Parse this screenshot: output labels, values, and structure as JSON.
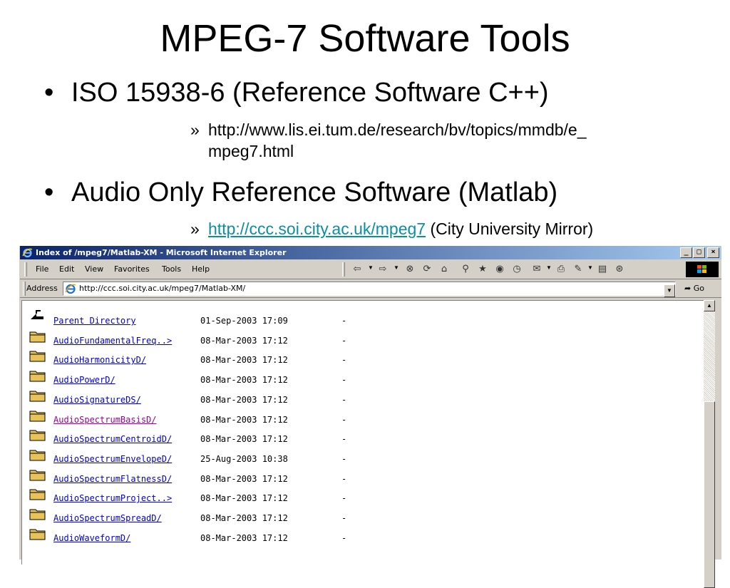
{
  "slide": {
    "title": "MPEG-7 Software Tools",
    "bullet_symbol": "•",
    "sub_symbol": "»",
    "bullets": [
      {
        "text": "ISO 15938-6 (Reference Software C++)",
        "sub_line1": "http://www.lis.ei.tum.de/research/bv/topics/mmdb/e_",
        "sub_line2": "mpeg7.html"
      },
      {
        "text": "Audio Only Reference Software (Matlab)",
        "sub_link": "http://ccc.soi.city.ac.uk/mpeg7",
        "sub_rest": " (City University Mirror)"
      }
    ]
  },
  "browser": {
    "title": "Index of /mpeg7/Matlab-XM - Microsoft Internet Explorer",
    "caption_buttons": [
      "_",
      "□",
      "×"
    ],
    "menus": [
      "File",
      "Edit",
      "View",
      "Favorites",
      "Tools",
      "Help"
    ],
    "toolbar_icons": [
      "back-icon",
      "forward-icon",
      "stop-icon",
      "refresh-icon",
      "home-icon",
      "search-icon",
      "favorites-icon",
      "media-icon",
      "history-icon",
      "mail-icon",
      "print-icon",
      "edit-icon",
      "discuss-icon",
      "messenger-icon"
    ],
    "address_label": "Address",
    "address_value": "http://ccc.soi.city.ac.uk/mpeg7/Matlab-XM/",
    "go_label": "Go",
    "listing": [
      {
        "name": "Parent Directory",
        "date": "01-Sep-2003 17:09",
        "size": "-",
        "icon": "parent-directory-icon",
        "visited": false
      },
      {
        "name": "AudioFundamentalFreq..>",
        "date": "08-Mar-2003 17:12",
        "size": "-",
        "icon": "folder-icon",
        "visited": false
      },
      {
        "name": "AudioHarmonicityD/",
        "date": "08-Mar-2003 17:12",
        "size": "-",
        "icon": "folder-icon",
        "visited": false
      },
      {
        "name": "AudioPowerD/",
        "date": "08-Mar-2003 17:12",
        "size": "-",
        "icon": "folder-icon",
        "visited": false
      },
      {
        "name": "AudioSignatureDS/",
        "date": "08-Mar-2003 17:12",
        "size": "-",
        "icon": "folder-icon",
        "visited": false
      },
      {
        "name": "AudioSpectrumBasisD/",
        "date": "08-Mar-2003 17:12",
        "size": "-",
        "icon": "folder-icon",
        "visited": true
      },
      {
        "name": "AudioSpectrumCentroidD/",
        "date": "08-Mar-2003 17:12",
        "size": "-",
        "icon": "folder-icon",
        "visited": false
      },
      {
        "name": "AudioSpectrumEnvelopeD/",
        "date": "25-Aug-2003 10:38",
        "size": "-",
        "icon": "folder-icon",
        "visited": false
      },
      {
        "name": "AudioSpectrumFlatnessD/",
        "date": "08-Mar-2003 17:12",
        "size": "-",
        "icon": "folder-icon",
        "visited": false
      },
      {
        "name": "AudioSpectrumProject..>",
        "date": "08-Mar-2003 17:12",
        "size": "-",
        "icon": "folder-icon",
        "visited": false
      },
      {
        "name": "AudioSpectrumSpreadD/",
        "date": "08-Mar-2003 17:12",
        "size": "-",
        "icon": "folder-icon",
        "visited": false
      },
      {
        "name": "AudioWaveformD/",
        "date": "08-Mar-2003 17:12",
        "size": "-",
        "icon": "folder-icon",
        "visited": false
      }
    ]
  },
  "colors": {
    "link": "#0000cc",
    "visited_link": "#990099",
    "slide_link": "#0b8fa0",
    "titlebar_start": "#0a246a",
    "titlebar_end": "#a6caf0",
    "chrome": "#d4d0c8"
  }
}
